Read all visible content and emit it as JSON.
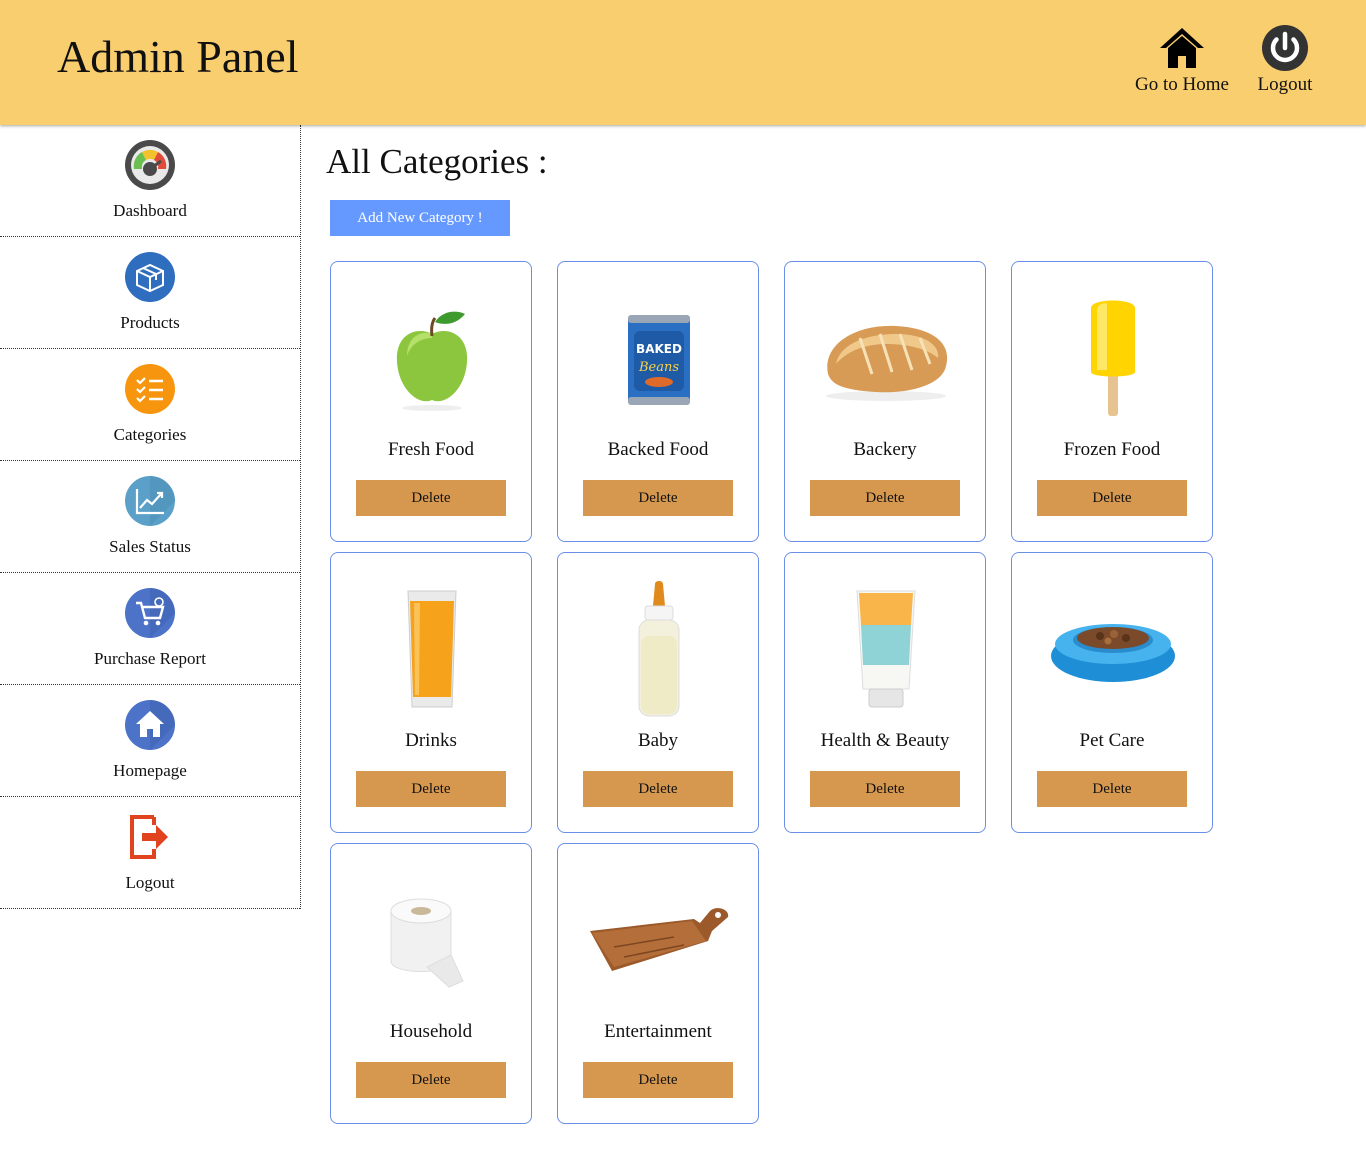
{
  "header": {
    "title": "Admin Panel",
    "home_label": "Go to Home",
    "logout_label": "Logout"
  },
  "sidebar": {
    "items": [
      {
        "label": "Dashboard",
        "icon": "dashboard-gauge-icon"
      },
      {
        "label": "Products",
        "icon": "box-icon"
      },
      {
        "label": "Categories",
        "icon": "checklist-icon"
      },
      {
        "label": "Sales Status",
        "icon": "chart-growth-icon"
      },
      {
        "label": "Purchase Report",
        "icon": "cart-icon"
      },
      {
        "label": "Homepage",
        "icon": "home-icon"
      },
      {
        "label": "Logout",
        "icon": "exit-icon"
      }
    ]
  },
  "main": {
    "title": "All Categories :",
    "add_button": "Add New Category !",
    "delete_label": "Delete",
    "categories": [
      {
        "name": "Fresh Food",
        "image": "green-apple"
      },
      {
        "name": "Backed Food",
        "image": "baked-beans-can"
      },
      {
        "name": "Backery",
        "image": "bread-loaf"
      },
      {
        "name": "Frozen Food",
        "image": "ice-pop"
      },
      {
        "name": "Drinks",
        "image": "orange-juice-glass"
      },
      {
        "name": "Baby",
        "image": "baby-bottle"
      },
      {
        "name": "Health & Beauty",
        "image": "cream-tube"
      },
      {
        "name": "Pet Care",
        "image": "pet-food-bowl"
      },
      {
        "name": "Household",
        "image": "toilet-paper-roll"
      },
      {
        "name": "Entertainment",
        "image": "cutting-board"
      }
    ]
  },
  "colors": {
    "header_bg": "#f9ce6e",
    "add_button_bg": "#6699ff",
    "delete_button_bg": "#d6984f",
    "card_border": "#6b8fe8"
  }
}
